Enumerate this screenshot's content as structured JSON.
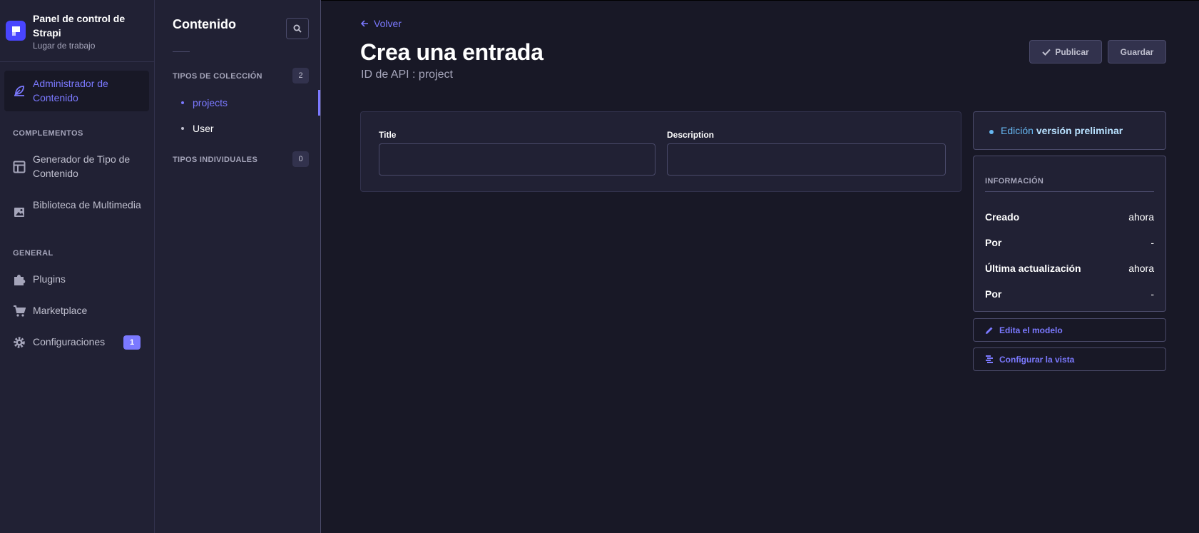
{
  "brand": {
    "title": "Panel de control de Strapi",
    "subtitle": "Lugar de trabajo"
  },
  "nav": {
    "active_item": "Administrador de Contenido",
    "sections": [
      {
        "title": "COMPLEMENTOS",
        "items": [
          "Generador de Tipo de Contenido",
          "Biblioteca de Multimedia"
        ]
      },
      {
        "title": "GENERAL",
        "items": [
          "Plugins",
          "Marketplace",
          "Configuraciones"
        ]
      }
    ],
    "config_badge": "1"
  },
  "subnav": {
    "title": "Contenido",
    "collection_section": "TIPOS DE COLECCIÓN",
    "collection_count": "2",
    "collection_items": [
      "projects",
      "User"
    ],
    "single_section": "TIPOS INDIVIDUALES",
    "single_count": "0"
  },
  "header": {
    "back_label": "Volver",
    "title": "Crea una entrada",
    "subtitle": "ID de API : project",
    "publish_label": "Publicar",
    "save_label": "Guardar"
  },
  "form": {
    "fields": [
      {
        "label": "Title",
        "value": ""
      },
      {
        "label": "Description",
        "value": ""
      }
    ]
  },
  "status": {
    "prefix": "Edición",
    "value": "versión preliminar"
  },
  "info": {
    "title": "INFORMACIÓN",
    "rows": [
      {
        "key": "Creado",
        "value": "ahora"
      },
      {
        "key": "Por",
        "value": "-"
      },
      {
        "key": "Última actualización",
        "value": "ahora"
      },
      {
        "key": "Por",
        "value": "-"
      }
    ]
  },
  "actions": {
    "edit_model": "Edita el modelo",
    "configure_view": "Configurar la vista"
  },
  "colors": {
    "background": "#181826",
    "panel": "#212134",
    "accent": "#7b79ff",
    "brand": "#4945ff"
  }
}
